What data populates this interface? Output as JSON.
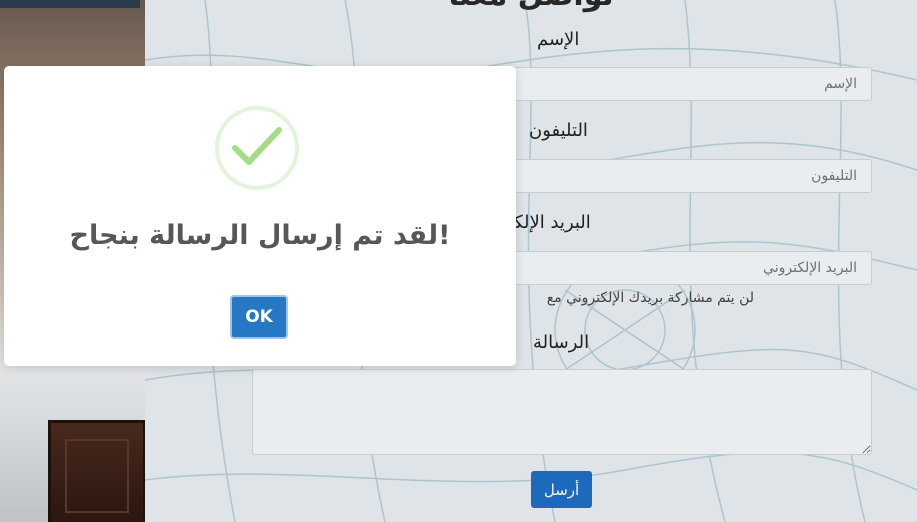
{
  "form": {
    "title": "تواصل معنا",
    "name_label": "الإسم",
    "name_placeholder": "الإسم",
    "phone_label": "التليفون",
    "phone_placeholder": "التليفون",
    "email_label": "البريد الإلكتروني",
    "email_placeholder": "البريد الإلكتروني",
    "email_help": "لن يتم مشاركة بريدك الإلكتروني مع",
    "message_label": "الرسالة",
    "send_label": "أرسل"
  },
  "modal": {
    "title": "!لقد تم إرسال الرسالة بنجاح",
    "ok_label": "OK",
    "icon": "success-check-icon"
  },
  "colors": {
    "accent": "#1f6fc5",
    "success": "#a5dc86"
  }
}
